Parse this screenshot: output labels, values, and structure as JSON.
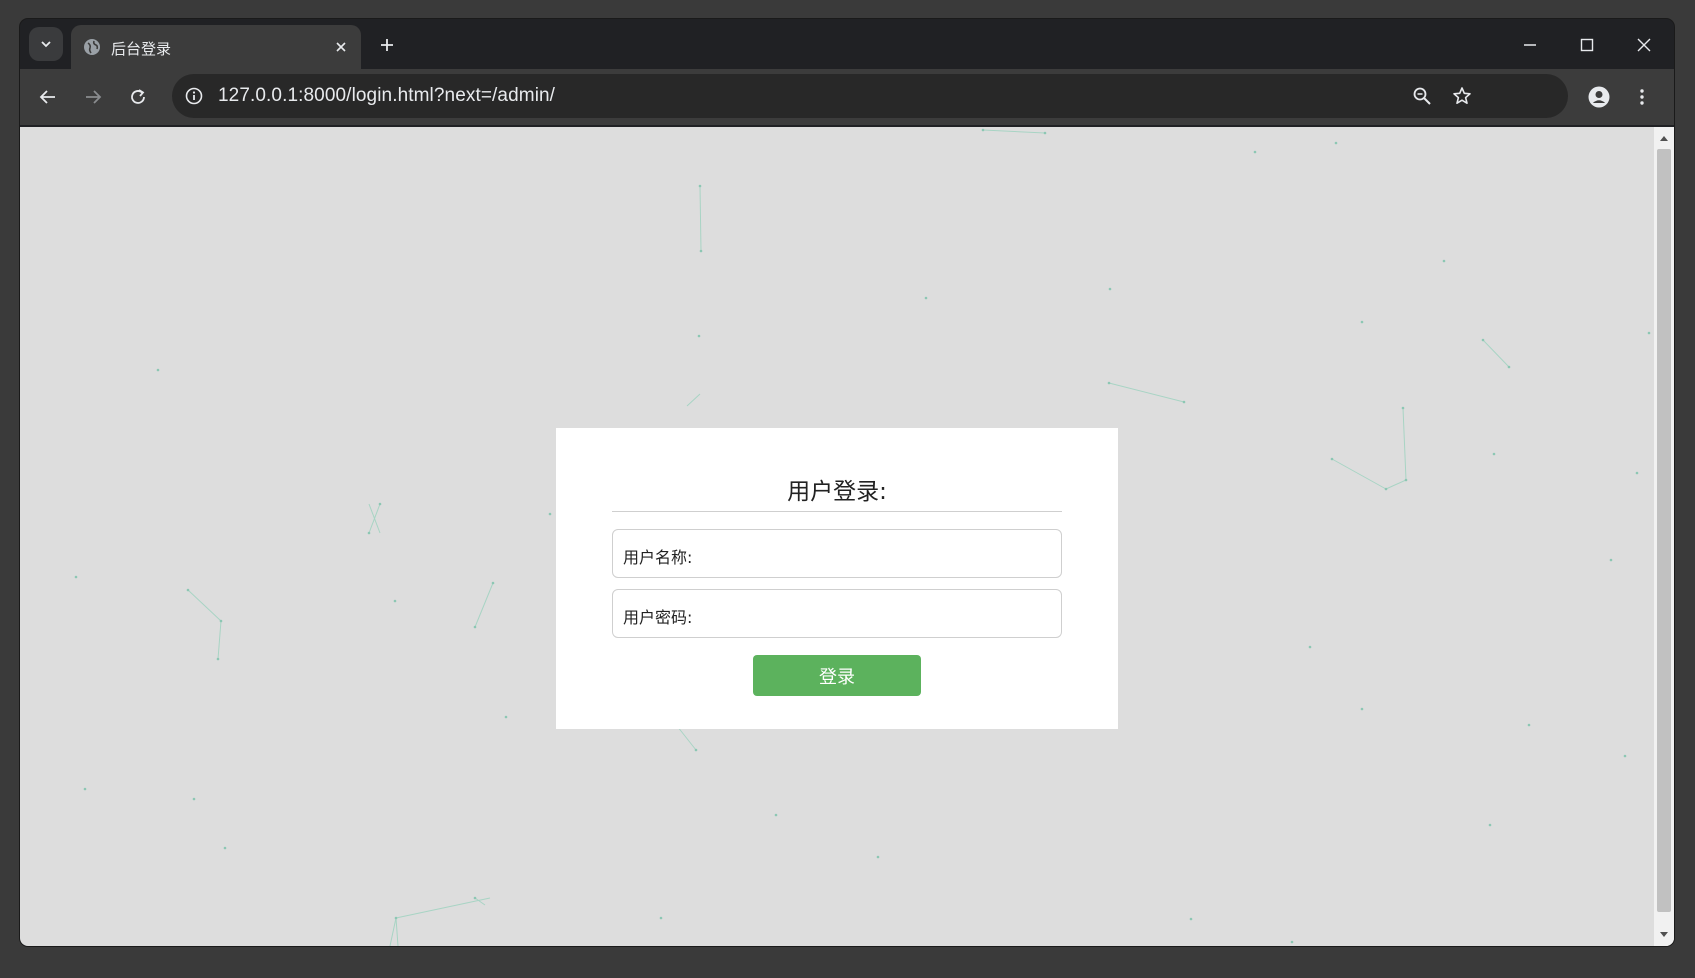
{
  "browser": {
    "tab": {
      "title": "后台登录"
    },
    "address_bar": {
      "url": "127.0.0.1:8000/login.html?next=/admin/"
    },
    "icons": {
      "tab_search": "chevron-down-icon",
      "favicon": "globe-icon",
      "tab_close": "close-icon",
      "new_tab": "plus-icon",
      "minimize": "minimize-icon",
      "maximize": "maximize-icon",
      "close_window": "close-icon",
      "back": "arrow-left-icon",
      "forward": "arrow-right-icon",
      "reload": "reload-icon",
      "site_info": "info-icon",
      "zoom": "zoom-out-icon",
      "bookmark": "star-icon",
      "profile": "person-icon",
      "menu": "kebab-menu-icon"
    }
  },
  "page": {
    "background_color": "#dddddd",
    "particle_color": "#7ec8b0",
    "login": {
      "title": "用户登录:",
      "username_label": "用户名称:",
      "username_value": "",
      "password_label": "用户密码:",
      "password_value": "",
      "submit_label": "登录",
      "submit_color": "#5cb25d"
    }
  }
}
